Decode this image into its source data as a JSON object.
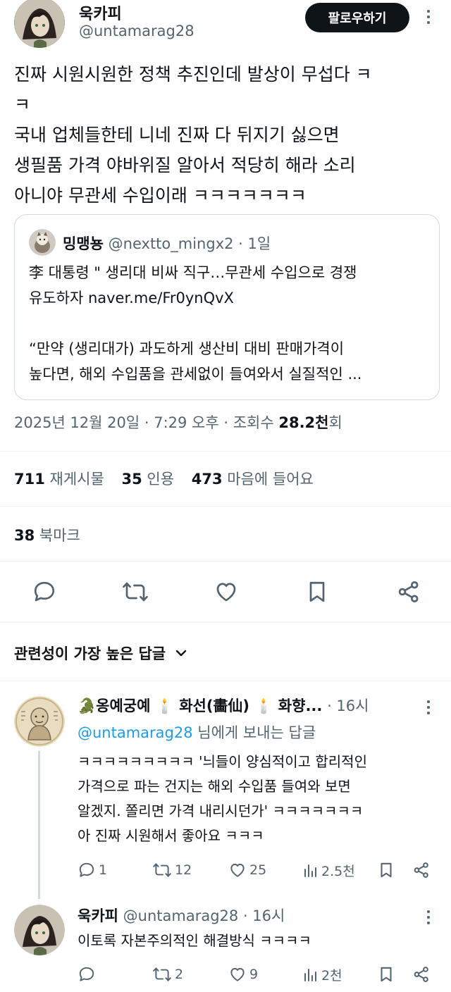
{
  "post": {
    "author_name": "욱카피",
    "author_handle": "@untamarag28",
    "follow_label": "팔로우하기",
    "body_lines": [
      "진짜 시원시원한 정책 추진인데 발상이 무섭다 ㅋ",
      "ㅋ",
      "국내 업체들한테 니네 진짜 다 뒤지기 싫으면",
      "생필품 가격 야바위질 알아서 적당히 해라 소리",
      "아니야 무관세 수입이래 ㅋㅋㅋㅋㅋㅋㅋ"
    ],
    "quote": {
      "author_name": "밍맹뇽",
      "author_handle": "@nextto_mingx2",
      "time": "· 1일",
      "lines": [
        "李 대통령  \" 생리대 비싸 직구…무관세 수입으로 경쟁",
        "유도하자 naver.me/Fr0ynQvX",
        "",
        "“만약 (생리대가) 과도하게 생산비 대비 판매가격이",
        "높다면, 해외 수입품을 관세없이 들여와서 실질적인 ..."
      ]
    },
    "timestamp": "2025년 12월 20일 · 7:29 오후 · 조회수 ",
    "views": "28.2천",
    "views_suffix": "회",
    "stats": {
      "reposts": "711",
      "reposts_label": "재게시물",
      "quotes": "35",
      "quotes_label": "인용",
      "likes": "473",
      "likes_label": "마음에 들어요",
      "bookmarks": "38",
      "bookmarks_label": "북마크"
    }
  },
  "replies_sort_label": "관련성이 가장 높은 답글",
  "replies": [
    {
      "author_name": "🐊옹예궁예 🕯️ 화선(畵仙) 🕯️ 화향...",
      "time": "· 16시",
      "reply_to_handle": "@untamarag28",
      "reply_to_suffix": " 님에게 보내는 답글",
      "lines": [
        "ㅋㅋㅋㅋㅋㅋㅋㅋㅋ '늬들이 양심적이고 합리적인",
        "가격으로 파는 건지는 해외 수입품 들여와 보면",
        "알겠지. 쫄리면 가격 내리시던가' ㅋㅋㅋㅋㅋㅋㅋ",
        "아 진짜 시원해서 좋아요 ㅋㅋㅋ"
      ],
      "replies_count": "1",
      "reposts_count": "12",
      "likes_count": "25",
      "views_count": "2.5천"
    },
    {
      "author_name": "욱카피",
      "author_handle": "@untamarag28",
      "time": "· 16시",
      "lines": [
        "이토록 자본주의적인 해결방식 ㅋㅋㅋㅋ"
      ],
      "replies_count": "",
      "reposts_count": "2",
      "likes_count": "9",
      "views_count": "2천"
    }
  ],
  "colors": {
    "accent": "#1d9bf0",
    "text": "#0f1419",
    "muted": "#536471",
    "divider": "#eff3f4"
  }
}
